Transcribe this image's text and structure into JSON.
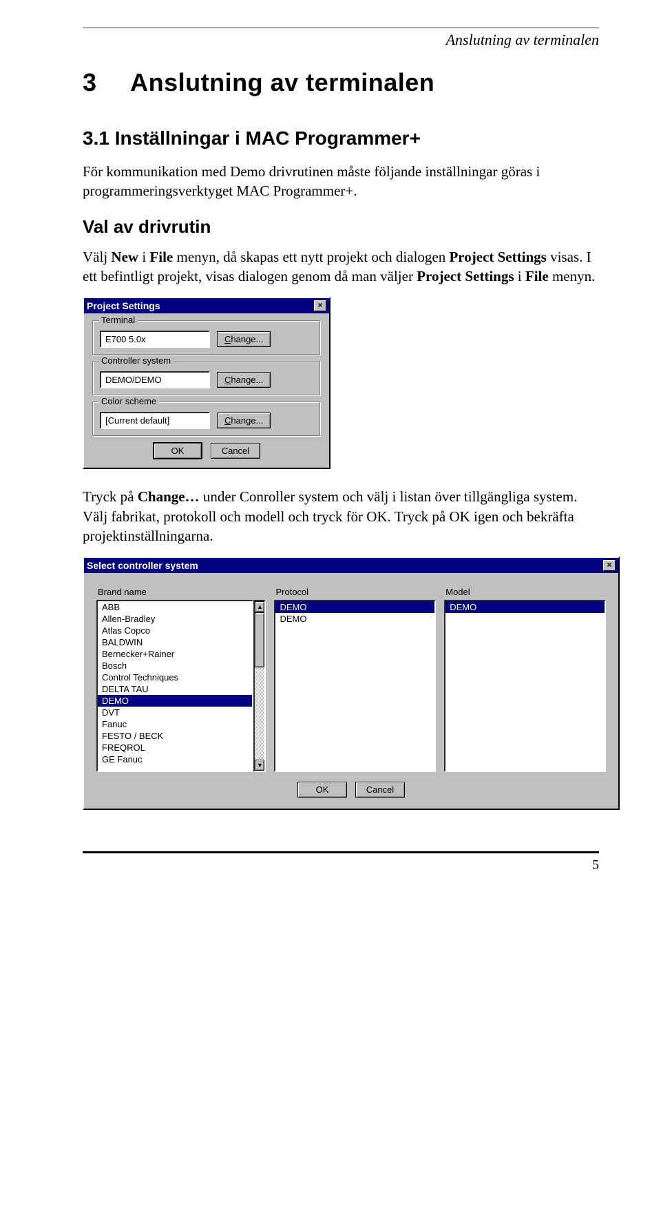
{
  "header": {
    "running_title": "Anslutning av terminalen"
  },
  "chapter": {
    "number": "3",
    "title": "Anslutning av terminalen"
  },
  "section": {
    "number": "3.1",
    "title": "Inställningar i MAC Programmer+"
  },
  "para1_plain": "För kommunikation med Demo drivrutinen måste följande inställningar göras i programmeringsverktyget MAC Programmer+.",
  "subsection": "Val av drivrutin",
  "para2_pre": "Välj ",
  "para2_b1": "New",
  "para2_mid1": " i ",
  "para2_b2": "File",
  "para2_mid2": " menyn, då skapas ett nytt projekt och dialogen ",
  "para2_b3": "Project Settings",
  "para2_mid3": " visas. I ett befintligt projekt, visas dialogen genom då man väljer ",
  "para2_b4": "Project Settings",
  "para2_mid4": " i ",
  "para2_b5": "File",
  "para2_end": " menyn.",
  "dialog1": {
    "title": "Project Settings",
    "close_glyph": "×",
    "group_terminal": "Terminal",
    "terminal_value": "E700 5.0x",
    "change_label": "Change...",
    "group_controller": "Controller system",
    "controller_value": "DEMO/DEMO",
    "group_color": "Color scheme",
    "color_value": "[Current default]",
    "ok_label": "OK",
    "cancel_label": "Cancel"
  },
  "para3_pre": "Tryck på ",
  "para3_b1": "Change…",
  "para3_rest": " under Conroller system och välj i listan över tillgängliga system. Välj fabrikat, protokoll och modell och tryck för OK. Tryck på OK igen och bekräfta projektinställningarna.",
  "dialog2": {
    "title": "Select controller system",
    "close_glyph": "×",
    "col_brand": "Brand name",
    "col_protocol": "Protocol",
    "col_model": "Model",
    "brand_items": [
      "ABB",
      "Allen-Bradley",
      "Atlas Copco",
      "BALDWIN",
      "Bernecker+Rainer",
      "Bosch",
      "Control Techniques",
      "DELTA TAU",
      "DEMO",
      "DVT",
      "Fanuc",
      "FESTO / BECK",
      "FREQROL",
      "GE Fanuc"
    ],
    "brand_selected_index": 8,
    "protocol_items": [
      "DEMO",
      "DEMO"
    ],
    "protocol_selected_index": 0,
    "model_items": [
      "DEMO"
    ],
    "model_selected_index": 0,
    "ok_label": "OK",
    "cancel_label": "Cancel",
    "scroll_up": "▲",
    "scroll_down": "▼"
  },
  "page_number": "5"
}
